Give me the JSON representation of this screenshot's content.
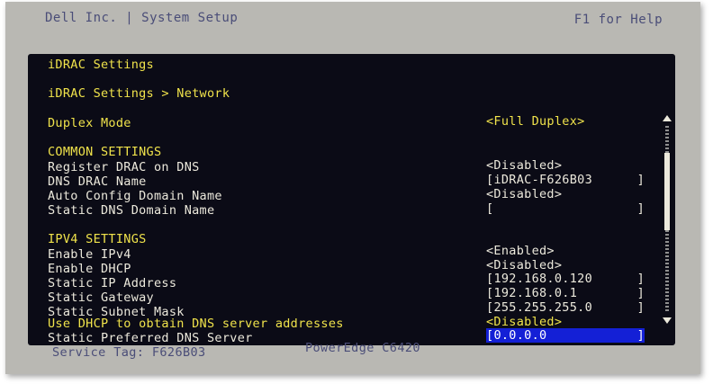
{
  "header": {
    "title": "Dell Inc. | System Setup",
    "help": "F1 for Help"
  },
  "panel": {
    "heading": "iDRAC Settings",
    "breadcrumb": "iDRAC Settings > Network",
    "duplex_label": "Duplex Mode",
    "duplex_value": "<Full Duplex>"
  },
  "common": {
    "section": "COMMON SETTINGS",
    "register_label": "Register DRAC on DNS",
    "register_value": "<Disabled>",
    "dns_name_label": "DNS DRAC Name",
    "dns_name_value": "iDRAC-F626B03",
    "auto_config_label": "Auto Config Domain Name",
    "auto_config_value": "<Disabled>",
    "static_domain_label": "Static DNS Domain Name",
    "static_domain_value": ""
  },
  "ipv4": {
    "section": "IPV4 SETTINGS",
    "enable_ipv4_label": "Enable IPv4",
    "enable_ipv4_value": "<Enabled>",
    "enable_dhcp_label": "Enable DHCP",
    "enable_dhcp_value": "<Disabled>",
    "static_ip_label": "Static IP Address",
    "static_ip_value": "192.168.0.120",
    "gateway_label": "Static Gateway",
    "gateway_value": "192.168.0.1",
    "subnet_label": "Static Subnet Mask",
    "subnet_value": "255.255.255.0",
    "dhcp_dns_label": "Use DHCP to obtain DNS server addresses",
    "dhcp_dns_value": "<Disabled>",
    "pref_dns_label": "Static Preferred DNS Server",
    "pref_dns_value": "0.0.0.0"
  },
  "footer": {
    "service_tag": "Service Tag: F626B03",
    "model": "PowerEdge C6420"
  },
  "colors": {
    "panel_bg": "#0b0b16",
    "highlight_text": "#f0e34b",
    "selection": "#1420d6",
    "bezel": "#b9b8b3"
  }
}
